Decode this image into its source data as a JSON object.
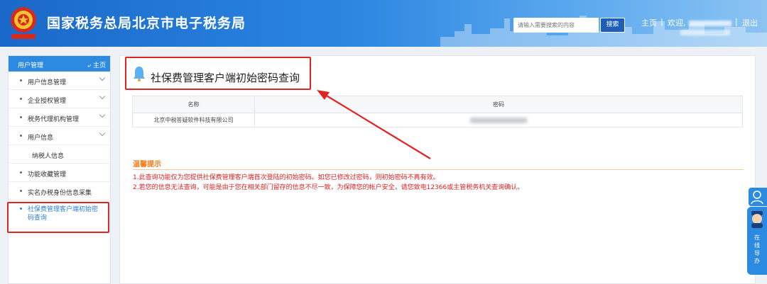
{
  "header": {
    "title": "国家税务总局北京市电子税务局",
    "search_placeholder": "请输入需要搜索的内容",
    "search_label": "搜索",
    "home_label": "主页",
    "welcome_label": "欢迎,",
    "logout_label": "退出",
    "separator": "|"
  },
  "sidebar": {
    "title": "用户管理",
    "home_label": "主页",
    "items": [
      {
        "label": "用户信息管理"
      },
      {
        "label": "企业授权管理"
      },
      {
        "label": "税务代理机构管理"
      },
      {
        "label": "用户信息"
      },
      {
        "label": "纳税人信息"
      },
      {
        "label": "功能收藏管理"
      },
      {
        "label": "实名办税身份信息采集"
      },
      {
        "label": "社保费管理客户端初始密码查询"
      }
    ]
  },
  "main": {
    "title": "社保费管理客户端初始密码查询",
    "table": {
      "headers": [
        "名称",
        "密码"
      ],
      "rows": [
        {
          "name": "北京中税答疑软件科技有限公司"
        }
      ]
    },
    "tips": {
      "title": "温馨提示",
      "lines": [
        "1.此查询功能仅为您提供社保费管理客户端首次登陆的初始密码。如您已修改过密码，则初始密码不再有效。",
        "2.若您的信息无法查询，可能是由于您在相关部门留存的信息不尽一致，为保障您的帐户安全，请您致电12366或主管税务机关查询确认。"
      ]
    }
  },
  "float_widget": {
    "label": "在线导办"
  },
  "colors": {
    "header_blue": "#1a68c9",
    "accent_blue": "#2c8ae0",
    "annotation_red": "#e02525",
    "tip_orange": "#f07d1a"
  }
}
